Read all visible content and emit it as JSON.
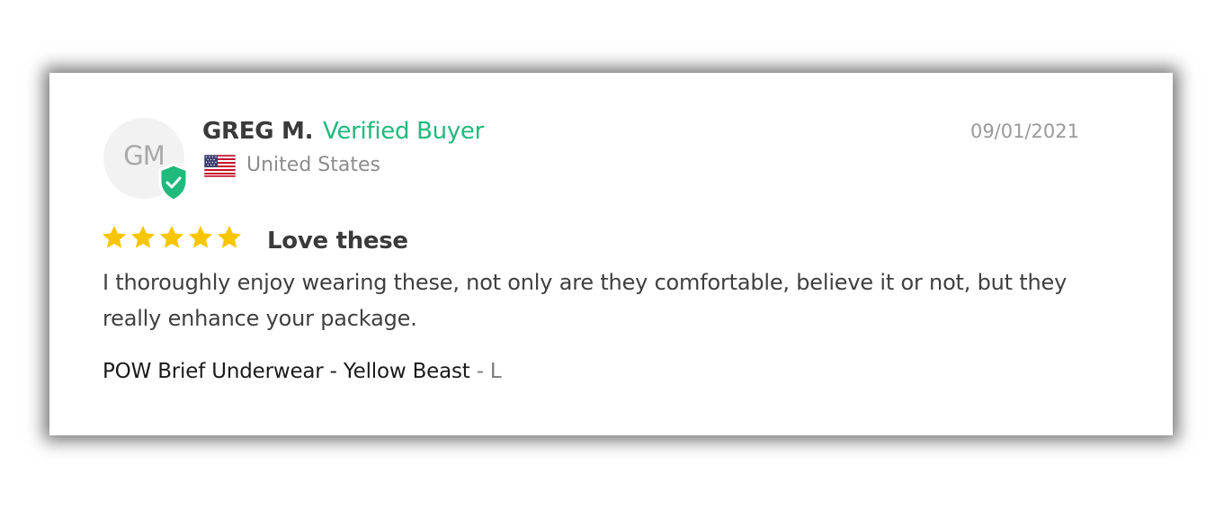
{
  "review": {
    "avatar_initials": "GM",
    "reviewer_name": "GREG M.",
    "verified_label": "Verified Buyer",
    "country": "United States",
    "date": "09/01/2021",
    "rating": 5,
    "rating_max": 5,
    "title": "Love these",
    "body": "I thoroughly enjoy wearing these, not only are they comfortable, believe it or not, but they really enhance your package.",
    "product_name": "POW Brief Underwear - Yellow Beast",
    "variant": " - L"
  },
  "colors": {
    "verified_green": "#1fba7c",
    "star_yellow": "#f7c600",
    "name_text": "#3a3a3a",
    "muted_text": "#8c8c8c"
  },
  "icons": {
    "badge": "shield-check-icon",
    "flag": "us-flag-icon",
    "star": "star-icon"
  }
}
